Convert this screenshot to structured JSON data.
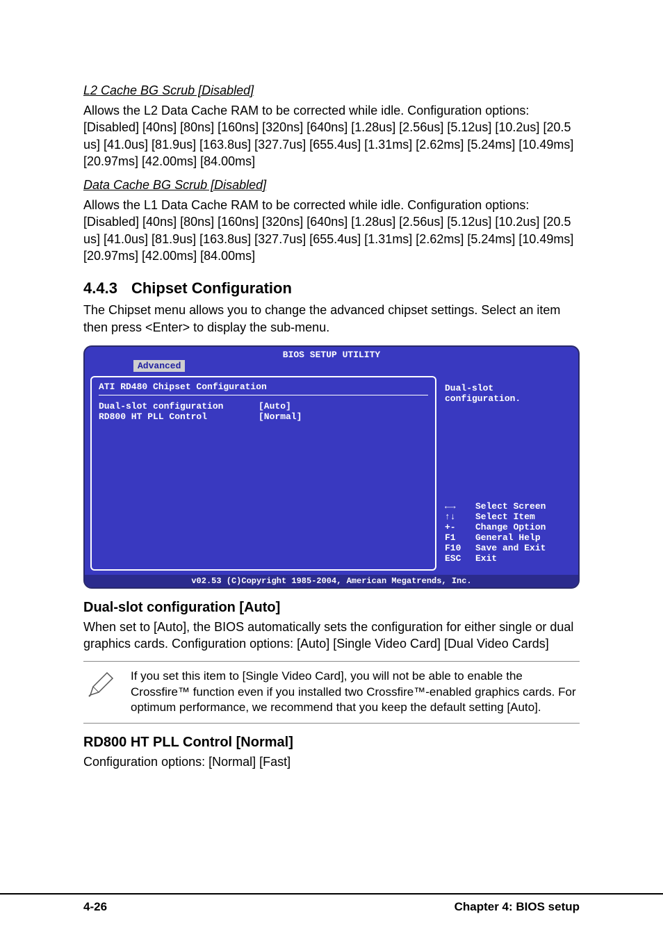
{
  "section1": {
    "heading": "L2 Cache BG Scrub [Disabled]",
    "body": "Allows the L2 Data Cache RAM to be corrected while idle. Configuration options: [Disabled] [40ns] [80ns] [160ns] [320ns] [640ns] [1.28us] [2.56us] [5.12us] [10.2us] [20.5 us] [41.0us] [81.9us] [163.8us] [327.7us] [655.4us] [1.31ms] [2.62ms] [5.24ms] [10.49ms] [20.97ms] [42.00ms] [84.00ms]"
  },
  "section2": {
    "heading": "Data Cache BG Scrub [Disabled]",
    "body": "Allows the L1 Data Cache RAM to be corrected while idle. Configuration options: [Disabled] [40ns] [80ns] [160ns] [320ns] [640ns] [1.28us] [2.56us] [5.12us] [10.2us] [20.5 us] [41.0us] [81.9us] [163.8us] [327.7us] [655.4us] [1.31ms] [2.62ms] [5.24ms] [10.49ms] [20.97ms] [42.00ms] [84.00ms]"
  },
  "h3": {
    "num": "4.4.3",
    "title": "Chipset Configuration"
  },
  "h3body": "The Chipset menu allows you to change the advanced chipset settings. Select an item then press <Enter> to display the sub-menu.",
  "bios": {
    "headerTitle": "BIOS SETUP UTILITY",
    "tab": "Advanced",
    "panelTitle": "ATI RD480 Chipset Configuration",
    "settings": [
      {
        "label": "Dual-slot configuration",
        "value": "[Auto]"
      },
      {
        "label": "RD800 HT PLL Control",
        "value": "[Normal]"
      }
    ],
    "help": "Dual-slot configuration.",
    "keys": [
      {
        "key": "←→",
        "desc": "Select Screen"
      },
      {
        "key": "↑↓",
        "desc": "Select Item"
      },
      {
        "key": "+-",
        "desc": "Change Option"
      },
      {
        "key": "F1",
        "desc": "General Help"
      },
      {
        "key": "F10",
        "desc": "Save and Exit"
      },
      {
        "key": "ESC",
        "desc": "Exit"
      }
    ],
    "footer": "v02.53 (C)Copyright 1985-2004, American Megatrends, Inc."
  },
  "dualslot": {
    "heading": "Dual-slot configuration [Auto]",
    "body": "When set to [Auto], the BIOS automatically sets the configuration for either single or dual graphics cards. Configuration options: [Auto] [Single  Video Card] [Dual Video Cards]"
  },
  "note": "If you set this item to [Single Video Card], you will not be able to enable the Crossfire™ function even if you installed two Crossfire™-enabled graphics cards. For optimum performance, we recommend that you keep the default setting [Auto].",
  "rd800": {
    "heading": "RD800 HT PLL Control [Normal]",
    "body": "Configuration options: [Normal] [Fast]"
  },
  "footer": {
    "left": "4-26",
    "right": "Chapter 4: BIOS setup"
  }
}
